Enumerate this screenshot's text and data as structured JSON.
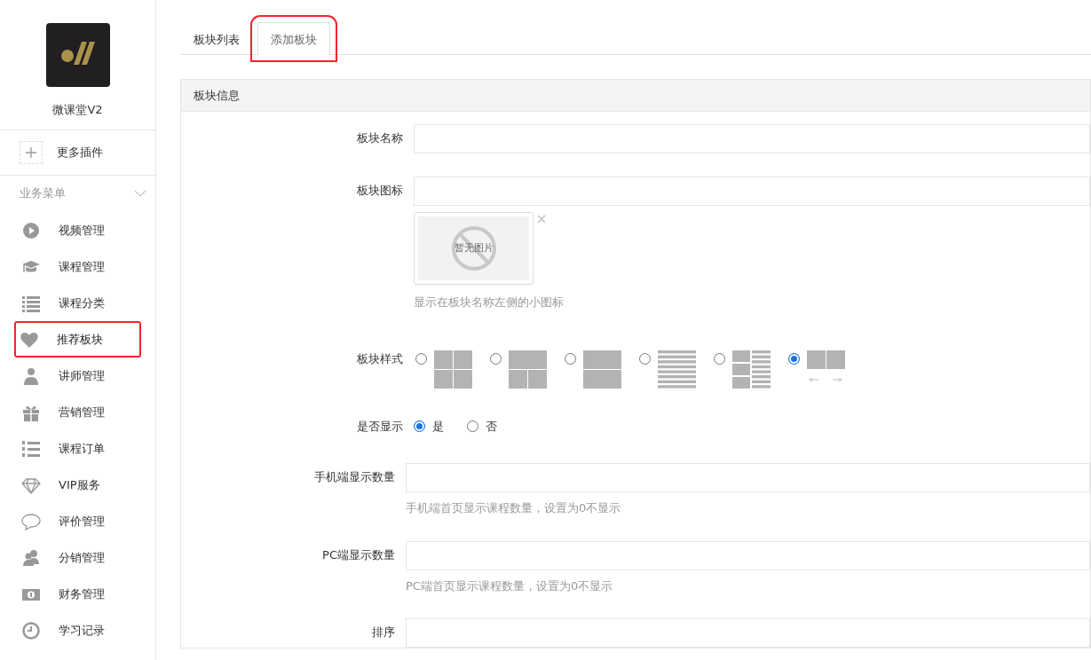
{
  "sidebar": {
    "app_name": "微课堂V2",
    "plugin_link": "更多插件",
    "menu_title": "业务菜单",
    "menu_expanded": true,
    "items": [
      {
        "kind": "play",
        "label": "视频管理",
        "selected": false,
        "highlighted": false
      },
      {
        "kind": "cap",
        "label": "课程管理",
        "selected": false,
        "highlighted": false
      },
      {
        "kind": "list",
        "label": "课程分类",
        "selected": false,
        "highlighted": false
      },
      {
        "kind": "heart",
        "label": "推荐板块",
        "selected": true,
        "highlighted": true
      },
      {
        "kind": "teacher",
        "label": "讲师管理",
        "selected": false,
        "highlighted": false
      },
      {
        "kind": "gift",
        "label": "营销管理",
        "selected": false,
        "highlighted": false
      },
      {
        "kind": "ordered",
        "label": "课程订单",
        "selected": false,
        "highlighted": false
      },
      {
        "kind": "diamond",
        "label": "VIP服务",
        "selected": false,
        "highlighted": false
      },
      {
        "kind": "chat",
        "label": "评价管理",
        "selected": false,
        "highlighted": false
      },
      {
        "kind": "people",
        "label": "分销管理",
        "selected": false,
        "highlighted": false
      },
      {
        "kind": "money",
        "label": "财务管理",
        "selected": false,
        "highlighted": false
      },
      {
        "kind": "clock",
        "label": "学习记录",
        "selected": false,
        "highlighted": false
      }
    ]
  },
  "tabs": [
    {
      "label": "板块列表",
      "selected": false,
      "highlighted": false
    },
    {
      "label": "添加板块",
      "selected": true,
      "highlighted": true
    }
  ],
  "panel": {
    "title": "板块信息",
    "name_field": {
      "label": "板块名称"
    },
    "icon_field": {
      "label": "板块图标",
      "image_placeholder": "暂无图片",
      "hint": "显示在板块名称左侧的小图标"
    },
    "style_field": {
      "label": "板块样式",
      "options": [
        {
          "kind": "grid4",
          "selected": false
        },
        {
          "kind": "top-two",
          "selected": false
        },
        {
          "kind": "two-rows",
          "selected": false
        },
        {
          "kind": "lines",
          "selected": false
        },
        {
          "kind": "mixed",
          "selected": false
        },
        {
          "kind": "slider",
          "selected": true
        }
      ]
    },
    "display_field": {
      "label": "是否显示",
      "options": [
        {
          "label": "是",
          "selected": true
        },
        {
          "label": "否",
          "selected": false
        }
      ]
    },
    "mobile_count": {
      "label": "手机端显示数量",
      "hint": "手机端首页显示课程数量，设置为0不显示"
    },
    "pc_count": {
      "label": "PC端显示数量",
      "hint": "PC端首页显示课程数量，设置为0不显示"
    },
    "sort_field": {
      "label": "排序"
    }
  }
}
